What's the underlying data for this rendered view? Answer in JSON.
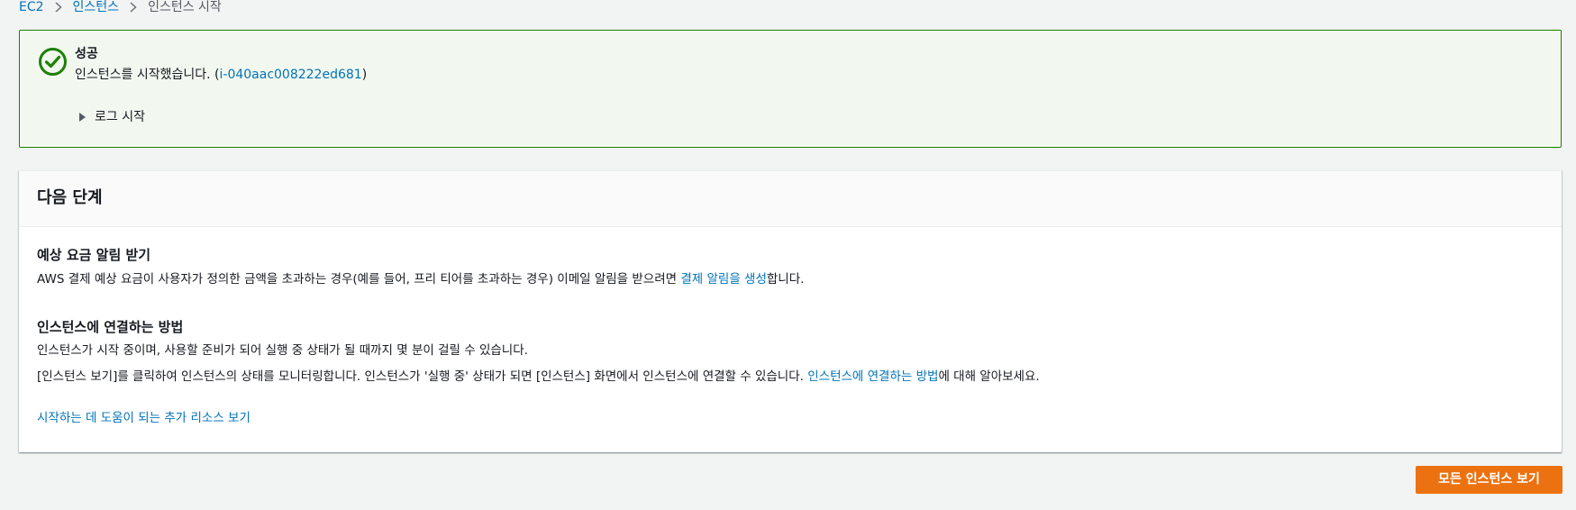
{
  "breadcrumb": {
    "items": [
      "EC2",
      "인스턴스",
      "인스턴스 시작"
    ]
  },
  "flash": {
    "status": "success",
    "header": "성공",
    "message_prefix": "인스턴스를 시작했습니다. (",
    "instance_id": "i-040aac008222ed681",
    "message_suffix": ")",
    "expander_label": "로그 시작"
  },
  "next_steps": {
    "title": "다음 단계",
    "billing": {
      "title": "예상 요금 알림 받기",
      "text_prefix": "AWS 결제 예상 요금이 사용자가 정의한 금액을 초과하는 경우(예를 들어, 프리 티어를 초과하는 경우) 이메일 알림을 받으려면 ",
      "link": "결제 알림을 생성",
      "text_suffix": "합니다."
    },
    "connect": {
      "title": "인스턴스에 연결하는 방법",
      "line1": "인스턴스가 시작 중이며, 사용할 준비가 되어 실행 중 상태가 될 때까지 몇 분이 걸릴 수 있습니다.",
      "line2_prefix": "[인스턴스 보기]를 클릭하여 인스턴스의 상태를 모니터링합니다. 인스턴스가 '실행 중' 상태가 되면 [인스턴스] 화면에서 인스턴스에 연결할 수 있습니다. ",
      "line2_link": "인스턴스에 연결하는 방법",
      "line2_suffix": "에 대해 알아보세요."
    },
    "more_resources_link": "시작하는 데 도움이 되는 추가 리소스 보기"
  },
  "actions": {
    "view_all_instances": "모든 인스턴스 보기"
  },
  "colors": {
    "link": "#0073bb",
    "success": "#1d8102",
    "success_bg": "#f2f8f0",
    "primary": "#ec7211",
    "page_bg": "#f2f3f3"
  },
  "icons": {
    "status": "check-circle-icon",
    "separator": "chevron-right-icon",
    "expander": "caret-right-icon"
  }
}
